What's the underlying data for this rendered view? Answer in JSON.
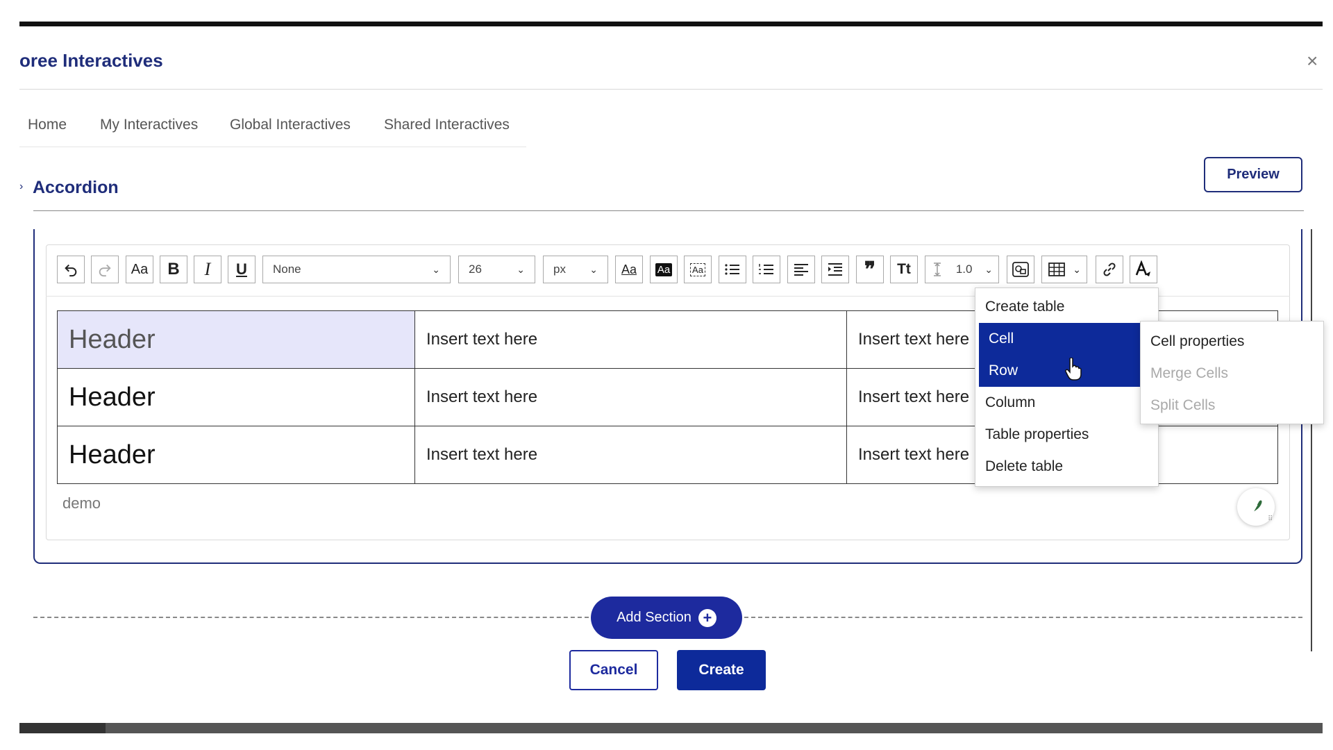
{
  "app": {
    "title": "oree Interactives",
    "close_label": "×"
  },
  "nav": {
    "tabs": [
      {
        "label": "Home"
      },
      {
        "label": "My Interactives"
      },
      {
        "label": "Global Interactives"
      },
      {
        "label": "Shared Interactives"
      }
    ]
  },
  "section": {
    "title": "Accordion",
    "preview_label": "Preview"
  },
  "toolbar": {
    "font_case_label": "Aa",
    "bold_label": "B",
    "italic_label": "I",
    "underline_label": "U",
    "font_family": "None",
    "font_size": "26",
    "font_unit": "px",
    "text_style_labels": [
      "Aa",
      "Aa",
      "Aa"
    ],
    "title_case_label": "Tt",
    "line_height": "1.0"
  },
  "table": {
    "rows": [
      {
        "header": "Header",
        "cells": [
          "Insert text here",
          "Insert text here"
        ]
      },
      {
        "header": "Header",
        "cells": [
          "Insert text here",
          "Insert text here"
        ]
      },
      {
        "header": "Header",
        "cells": [
          "Insert text here",
          "Insert text here"
        ]
      }
    ]
  },
  "editor": {
    "demo_text": "demo"
  },
  "table_menu": {
    "items": [
      "Create table",
      "Cell",
      "Row",
      "Column",
      "Table properties",
      "Delete table"
    ],
    "submenu": [
      "Cell properties",
      "Merge Cells",
      "Split Cells"
    ]
  },
  "actions": {
    "add_section_label": "Add Section",
    "add_section_plus": "+",
    "cancel_label": "Cancel",
    "create_label": "Create"
  },
  "colors": {
    "brand": "#1f2d7a",
    "accent": "#0d2a9a",
    "selected_cell": "#e6e6fa"
  }
}
